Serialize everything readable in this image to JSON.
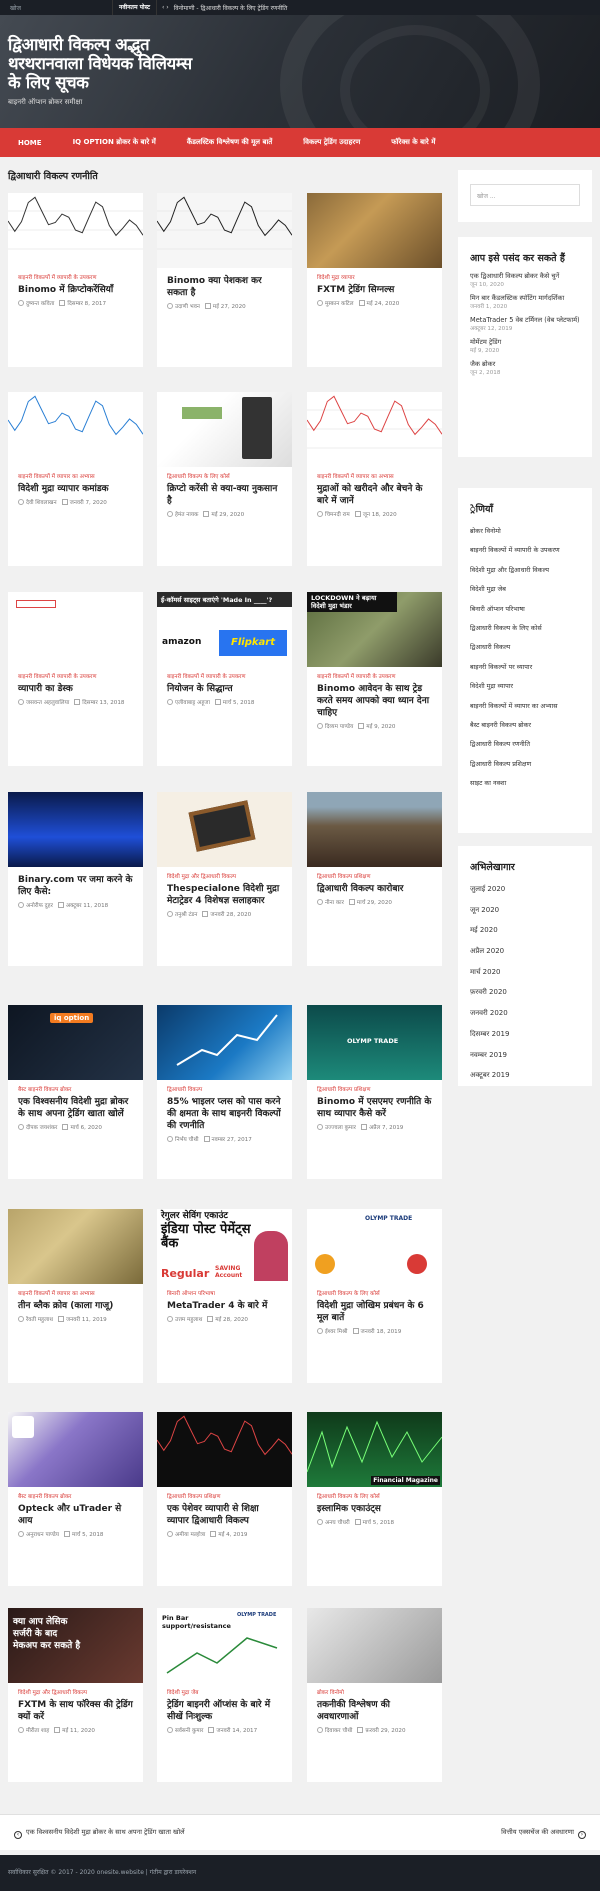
{
  "topbar": {
    "label": "नवीनतम पोस्ट",
    "news": "विनोमाणी - द्विआधारी विकल्प के लिए ट्रेडिंग रणनीति"
  },
  "header": {
    "title": "द्विआधारी विकल्प अद्भुत थरथरानवाला विधेयक विलियम्स के लिए सूचक",
    "description": "बाइनरी ऑप्शन ब्रोकर समीक्षा"
  },
  "nav": [
    "HOME",
    "IQ OPTION ब्रोकर के बारे में",
    "कैंडलस्टिक विश्लेषण की मूल बातें",
    "विकल्प ट्रेडिंग उदाहरण",
    "फॉरेक्स के बारे में"
  ],
  "page_title": "द्विआधारी विकल्प रणनीति",
  "posts": [
    {
      "cat": "बाइनरी विकल्पों में व्यापारी के उपकरण",
      "title": "Binomo में क्रिप्टोकरेंसियाँ",
      "author": "दुष्यन्त कविता",
      "date": "दिसम्बर 8, 2017"
    },
    {
      "cat": "",
      "title": "Binomo क्या पेशकश कर सकता है",
      "author": "उदाणी भवन",
      "date": "मई 27, 2020"
    },
    {
      "cat": "विदेशी मुद्रा व्यापार",
      "title": "FXTM ट्रेडिंग सिग्नल्स",
      "author": "मुस्कान कटिल",
      "date": "मई 24, 2020"
    },
    {
      "cat": "बाइनरी विकल्पों में व्यापार का अभ्यास",
      "title": "विदेशी मुद्रा व्यापार कमांडक",
      "author": "देवी शिवलाखन",
      "date": "जनवरी 7, 2020"
    },
    {
      "cat": "द्विआधारी विकल्प के लिए कोर्स",
      "title": "क्रिप्टो करेंसी से क्या-क्या नुकसान है",
      "author": "हेमंत नायक",
      "date": "मई 29, 2020"
    },
    {
      "cat": "बाइनरी विकल्पों में व्यापार का अभ्यास",
      "title": "मुद्राओं को खरीदने और बेचने के बारे में जानें",
      "author": "चिमनदी राम",
      "date": "जून 18, 2020"
    },
    {
      "cat": "बाइनरी विकल्पों में व्यापारी के उपकरण",
      "title": "व्यापारी का डेस्क",
      "author": "जसवन्त अहलुवालिया",
      "date": "दिसम्बर 13, 2018"
    },
    {
      "cat": "बाइनरी विकल्पों में व्यापारी के उपकरण",
      "title": "नियोजन के सिद्धान्त",
      "author": "एलीवाबाट्ट अहूजा",
      "date": "मार्च 5, 2018"
    },
    {
      "cat": "बाइनरी विकल्पों में व्यापारी के उपकरण",
      "title": "Binomo आवेदन के साथ ट्रेड करते समय आपको क्या ध्यान देना चाहिए",
      "author": "दिव्यम पाण्डेय",
      "date": "मई 9, 2020"
    },
    {
      "cat": "",
      "title": "Binary.com पर जमा करने के लिए कैसे:",
      "author": "अनोरीफ दुहर",
      "date": "अक्टूबर 11, 2018"
    },
    {
      "cat": "विदेशी मुद्रा और द्विआधारी विकल्प",
      "title": "Thespecialone विदेशी मुद्रा मेटाट्रेडर 4 विशेषज्ञ सलाहकार",
      "author": "तनुश्री टंडन",
      "date": "जनवरी 28, 2020"
    },
    {
      "cat": "द्विआधारी विकल्प प्रशिक्षण",
      "title": "द्विआधारी विकल्प कारोबार",
      "author": "नीना कार",
      "date": "मार्च 29, 2020"
    },
    {
      "cat": "बैस्ट बाइनरी विकल्प ब्रोकर",
      "title": "एक विश्वसनीय विदेशी मुद्रा ब्रोकर के साथ अपना ट्रेडिंग खाता खोलें",
      "author": "दीपक जयशंकर",
      "date": "मार्च 6, 2020"
    },
    {
      "cat": "द्विआधारी विकल्प",
      "title": "85% भाइलर प्लस को पास करने की क्षमता के साथ बाइनरी विकल्पों की रणनीति",
      "author": "निर्भय चौथी",
      "date": "नवम्बर 27, 2017"
    },
    {
      "cat": "द्विआधारी विकल्प प्रशिक्षण",
      "title": "Binomo में एसएमए रणनीति के साथ व्यापार कैसे करें",
      "author": "उज्ज्वला कुमार",
      "date": "अप्रैल 7, 2019"
    },
    {
      "cat": "बाइनरी विकल्पों में व्यापार का अभ्यास",
      "title": "तीन ब्लैक क्रोव (काला गाजू)",
      "author": "रेवती महुलाथ",
      "date": "जनवरी 11, 2019"
    },
    {
      "cat": "बिनारी ऑप्शन परिभाषा",
      "title": "MetaTrader 4 के बारे में",
      "author": "उत्तम महुलाथ",
      "date": "मई 28, 2020"
    },
    {
      "cat": "द्विआधारी विकल्प के लिए कोर्स",
      "title": "विदेशी मुद्रा जोखिम प्रबंधन के 6 मूल बातें",
      "author": "ईश्वर मिश्री",
      "date": "जनवरी 18, 2019"
    },
    {
      "cat": "बैस्ट बाइनरी विकल्प ब्रोकर",
      "title": "Opteck और uTrader से आय",
      "author": "अनुराधन पाण्डेय",
      "date": "मार्च 5, 2018"
    },
    {
      "cat": "द्विआधारी विकल्प प्रशिक्षण",
      "title": "एक पेशेवर व्यापारी से शिक्षा व्यापार द्विआधारी विकल्प",
      "author": "अमीया मल्होत्रा",
      "date": "मई 4, 2019"
    },
    {
      "cat": "द्विआधारी विकल्प के लिए कोर्स",
      "title": "इस्लामिक एकाउंट्स",
      "author": "अनघ चौधरी",
      "date": "मार्च 5, 2018"
    },
    {
      "cat": "विदेशी मुद्रा और द्विआधारी विकल्प",
      "title": "FXTM के साथ फॉरेक्स की ट्रेडिंग क्यों करें",
      "author": "मीरीता शाह",
      "date": "मई 11, 2020"
    },
    {
      "cat": "विदेशी मुद्रा जेब",
      "title": "ट्रेडिंग बाइनरी ऑप्शंस के बारे में सीखें निःशुल्क",
      "author": "सर्वसनी कुमार",
      "date": "जनवरी 14, 2017"
    },
    {
      "cat": "ब्रोकर विनोमो",
      "title": "तकनीकी विश्लेषण की अवधारणाओं",
      "author": "दिवाकर चौथी",
      "date": "फ़रवरी 29, 2020"
    }
  ],
  "image_texts": {
    "amazon_banner": "ई-कॉमर्स साइट्स बताएंगे 'Made In ____'?",
    "amazon": "amazon",
    "flipkart": "Flipkart",
    "lockdown": "LOCKDOWN ने बढ़ाया विदेशी मुद्रा भंडार",
    "iqoption": "iq option",
    "olymp": "OLYMP TRADE",
    "postbank1": "रेगुलर सेविंग एकाउंट",
    "postbank2": "इंडिया पोस्ट पेमेंट्स बैंक",
    "postbank3": "Regular",
    "postbank4": "SAVING Account",
    "financial": "Financial Magazine",
    "lasik": "क्या आप लेसिक सर्जरी के बाद मेकअप कर सकते है",
    "pinbar": "Pin Bar support/resistance"
  },
  "sidebar": {
    "search_placeholder": "खोज ...",
    "recent_title": "आप इसे पसंद कर सकते हैं",
    "recent": [
      {
        "title": "एक द्विआधारी विकल्प ब्रोकर कैसे चुनें",
        "date": "जून 10, 2020"
      },
      {
        "title": "मिन बार कैंडलस्टिक स्पॉटिंग मार्गदर्शिका",
        "date": "जनवरी 1, 2020"
      },
      {
        "title": "MetaTrader 5 वेब टर्मिनल (वेब प्लेटफार्म)",
        "date": "अक्टूबर 12, 2019"
      },
      {
        "title": "मोमेंटम ट्रेडिंग",
        "date": "मई 9, 2020"
      },
      {
        "title": "जैक ब्रोकर",
        "date": "जून 2, 2018"
      }
    ],
    "categories_title": "्रेणियाँ",
    "categories": [
      "ब्रोकर विनोमो",
      "बाइनरी विकल्पों में व्यापारी के उपकरण",
      "विदेशी मुद्रा और द्विआधारी विकल्प",
      "विदेशी मुद्रा जेब",
      "बिनारी ऑप्शन परिभाषा",
      "द्विआधारी विकल्प के लिए कोर्स",
      "द्विआधारी विकल्प",
      "बाइनरी विकल्पों पर व्यापार",
      "विदेशी मुद्रा व्यापार",
      "बाइनरी विकल्पों में व्यापार का अभ्यास",
      "बैस्ट बाइनरी विकल्प ब्रोकर",
      "द्विआधारी विकल्प रणनीति",
      "द्विआधारी विकल्प प्रशिक्षण",
      "साइट का नक्शा"
    ],
    "archive_title": "अभिलेखागार",
    "archive": [
      "जुलाई 2020",
      "जून 2020",
      "मई 2020",
      "अप्रैल 2020",
      "मार्च 2020",
      "फ़रवरी 2020",
      "जनवरी 2020",
      "दिसम्बर 2019",
      "नवम्बर 2019",
      "अक्टूबर 2019"
    ]
  },
  "postnav": {
    "prev": "एक विश्वसनीय विदेशी मुद्रा ब्रोकर के साथ अपना ट्रेडिंग खाता खोलें",
    "next": "वित्तीय एक्सचेंज की अवधारणा"
  },
  "footer": {
    "text": "सर्वाधिकार सुरक्षित © 2017 - 2020 onesite.website  |  गंतीम द्वारा डायरेक्शन"
  },
  "colors": {
    "accent": "#d93a36",
    "dark": "#1b1f26"
  }
}
